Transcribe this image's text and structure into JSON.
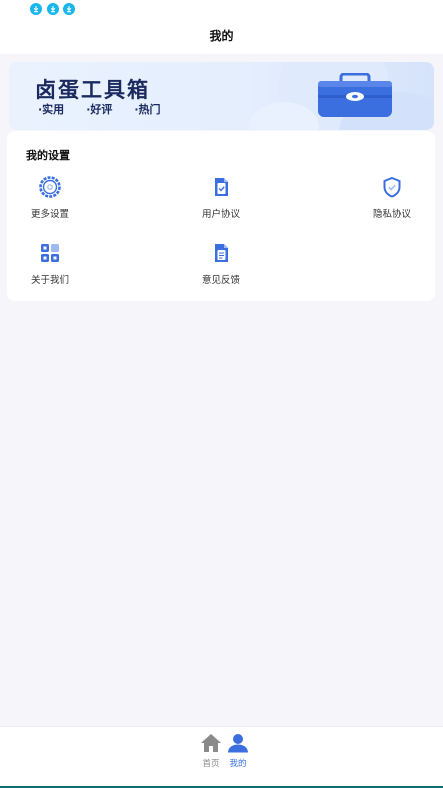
{
  "header": {
    "title": "我的"
  },
  "banner": {
    "title": "卤蛋工具箱",
    "tags": [
      "·实用",
      "·好评",
      "·热门"
    ]
  },
  "settings": {
    "title": "我的设置",
    "items": [
      {
        "label": "更多设置",
        "icon": "settings-gear-icon"
      },
      {
        "label": "用户协议",
        "icon": "document-check-icon"
      },
      {
        "label": "隐私协议",
        "icon": "shield-check-icon"
      },
      {
        "label": "关于我们",
        "icon": "grid-apps-icon"
      },
      {
        "label": "意见反馈",
        "icon": "feedback-document-icon"
      }
    ]
  },
  "tabbar": {
    "tabs": [
      {
        "label": "首页",
        "icon": "home-icon",
        "active": false
      },
      {
        "label": "我的",
        "icon": "user-icon",
        "active": true
      }
    ]
  },
  "colors": {
    "accent": "#3b6fe0",
    "download_badge": "#18b6ea",
    "inactive": "#888888"
  }
}
